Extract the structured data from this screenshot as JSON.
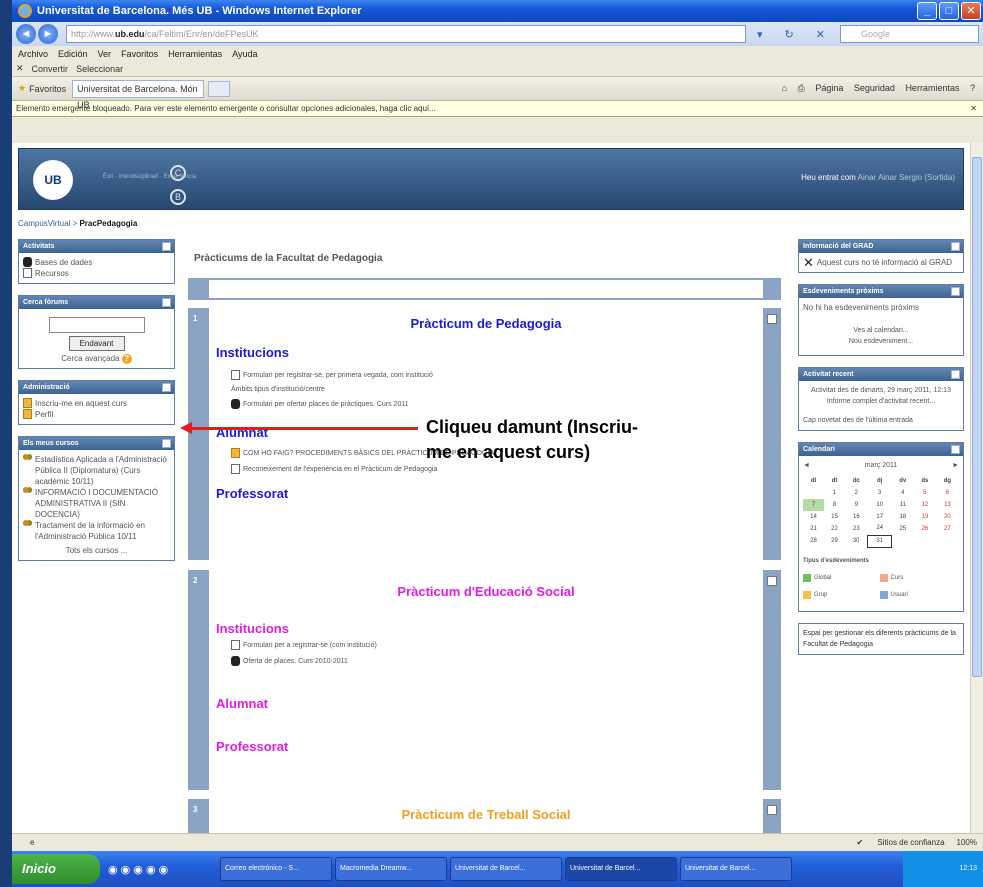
{
  "window": {
    "title": "Universitat de Barcelona. Més UB - Windows Internet Explorer",
    "address_prefix": "http://www.",
    "address_domain": "ub.edu",
    "address_suffix": "/ca/Feltim/Enr/en/deFPesUK",
    "search_placeholder": "Google"
  },
  "menu": [
    "Archivo",
    "Edición",
    "Ver",
    "Favoritos",
    "Herramientas",
    "Ayuda"
  ],
  "convert": {
    "convert_label": "Convertir",
    "select_label": "Seleccionar"
  },
  "favbar": {
    "favorites_label": "Favoritos",
    "tab_label": "Universitat de Barcelona. Món UB",
    "right_items": [
      "Página",
      "Seguridad",
      "Herramientas"
    ]
  },
  "infobar": "Elemento emergente bloqueado. Para ver este elemento emergente o consultar opciones adicionales, haga clic aquí...",
  "header": {
    "logo_text": "UB",
    "circle_c": "C",
    "circle_b": "B",
    "subtext": "Èxit · Interdisciplinari · Excel·lència",
    "login_prefix": "Heu entrat com",
    "login_user": "Ainar Ainar Sergio (Sortida)"
  },
  "breadcrumb": {
    "root": "CampusVirtual",
    "sep": ">",
    "current": "PracPedagogia"
  },
  "left": {
    "activities": {
      "title": "Activitats",
      "items": [
        "Bases de dades",
        "Recursos"
      ]
    },
    "search": {
      "title": "Cerca fòrums",
      "button": "Endavant",
      "advanced": "Cerca avançada"
    },
    "admin": {
      "title": "Administració",
      "items": [
        "Inscriu-me en aquest curs",
        "Perfil"
      ]
    },
    "courses": {
      "title": "Els meus cursos",
      "items": [
        "Estadística Aplicada a l'Administració Pública II (Diplomatura) (Curs acadèmic 10/11)",
        "INFORMACIÓ I DOCUMENTACIÓ ADMINISTRATIVA II (SIN DOCENCIA)",
        "Tractament de la informació en l'Administració Pública 10/11"
      ],
      "all": "Tots els cursos ..."
    }
  },
  "main": {
    "title": "Pràcticums de la Facultat de Pedagogia",
    "sections": [
      {
        "num": "1",
        "title": "Pràcticum de Pedagogia",
        "color": "#1a1adb",
        "h_institucions": "Institucions",
        "inst_items": [
          "Formulari per registrar-se, per primera vegada, com institució",
          "Àmbits tipus d'institució/centre",
          "Formulari per ofertar places de pràctiques. Curs 2011"
        ],
        "h_alumnat": "Alumnat",
        "alum_items": [
          "COM HO FAIG? PROCEDIMENTS BÀSICS DEL PRÀCTICUM DE PEDAGOGIA",
          "Reconeixement de l'experiència en el Pràcticum de Pedagogia"
        ],
        "h_professorat": "Professorat"
      },
      {
        "num": "2",
        "title": "Pràcticum d'Educació Social",
        "color": "#e01ee0",
        "h_institucions": "Institucions",
        "inst_items": [
          "Formulari per a registrar-se (com institució)",
          "Oferta de places. Curs 2010-2011"
        ],
        "h_alumnat": "Alumnat",
        "h_professorat": "Professorat"
      },
      {
        "num": "3",
        "title": "Pràcticum de Treball Social",
        "color": "#f0a020"
      }
    ]
  },
  "annotation": "Cliqueu damunt (Inscriu-me en aquest curs)",
  "annotation_line1": "Cliqueu damunt (Inscriu-",
  "annotation_line2": "me en aquest curs)",
  "right": {
    "grad": {
      "title": "Informació del GRAD",
      "text": "Aquest curs no té informació al GRAD"
    },
    "events": {
      "title": "Esdeveniments pròxims",
      "text": "No hi ha esdeveniments pròxims",
      "link1": "Ves al calendari...",
      "link2": "Nou esdeveniment..."
    },
    "recent": {
      "title": "Activitat recent",
      "text": "Activitat des de dimarts, 29 març 2011, 12:13",
      "link": "Informe complet d'activitat recent...",
      "none": "Cap novetat des de l'última entrada"
    },
    "calendar": {
      "title": "Calendari",
      "month": "març 2011",
      "prev": "◄",
      "next": "►",
      "weekdays": [
        "dl",
        "dt",
        "dc",
        "dj",
        "dv",
        "ds",
        "dg"
      ],
      "weeks": [
        [
          "",
          "1",
          "2",
          "3",
          "4",
          "5",
          "6"
        ],
        [
          "7",
          "8",
          "9",
          "10",
          "11",
          "12",
          "13"
        ],
        [
          "14",
          "15",
          "16",
          "17",
          "18",
          "19",
          "20"
        ],
        [
          "21",
          "22",
          "23",
          "24",
          "25",
          "26",
          "27"
        ],
        [
          "28",
          "29",
          "30",
          "31",
          "",
          "",
          ""
        ]
      ],
      "legend_title": "Tipus d'esdeveniments",
      "legend": [
        "Global",
        "Curs",
        "Grup",
        "Usuari"
      ]
    },
    "space": "Espai per gestionar els diferents pràcticums de la Facultat de Pedagogia"
  },
  "status": {
    "trusted": "Sitios de confianza",
    "zoom": "100%"
  },
  "taskbar": {
    "start": "Inicio",
    "tasks": [
      "Correo electrónico - S...",
      "Macromedia Dreamw...",
      "Universitat de Barcel...",
      "Universitat de Barcel...",
      "Universitat de Barcel..."
    ],
    "clock": "12:13"
  }
}
